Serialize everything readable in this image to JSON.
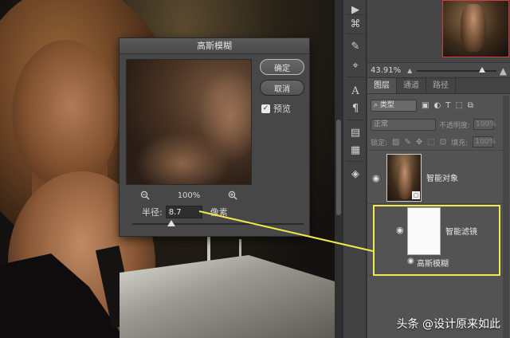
{
  "dialog": {
    "title": "高斯模糊",
    "ok_label": "确定",
    "cancel_label": "取消",
    "preview_label": "预览",
    "preview_checked": true,
    "zoom_level": "100%",
    "radius_label": "半径:",
    "radius_value": "8.7",
    "radius_unit": "像素",
    "radius_slider_fraction": 0.23
  },
  "navigator": {
    "zoom": "43.91%",
    "slider_fraction": 0.78
  },
  "layers_panel": {
    "tabs": [
      {
        "label": "图层",
        "active": true
      },
      {
        "label": "通道",
        "active": false
      },
      {
        "label": "路径",
        "active": false
      }
    ],
    "filter_kind": "类型",
    "blend_mode": "正常",
    "opacity_label": "不透明度:",
    "opacity_value": "100%",
    "lock_label": "锁定:",
    "fill_label": "填充:",
    "fill_value": "100%",
    "layers": [
      {
        "name": "智能对象",
        "visible": true
      },
      {
        "name": "智能滤镜",
        "visible": true
      },
      {
        "name": "高斯模糊",
        "visible": true
      }
    ]
  },
  "watermark": "头条 @设计原来如此",
  "colors": {
    "highlight": "#f4e94a",
    "panel_bg": "#535353",
    "dialog_bg": "#474747"
  },
  "icons": {
    "zoom_out": "zoom-out-icon",
    "zoom_in": "zoom-in-icon",
    "eye": "eye-icon"
  }
}
